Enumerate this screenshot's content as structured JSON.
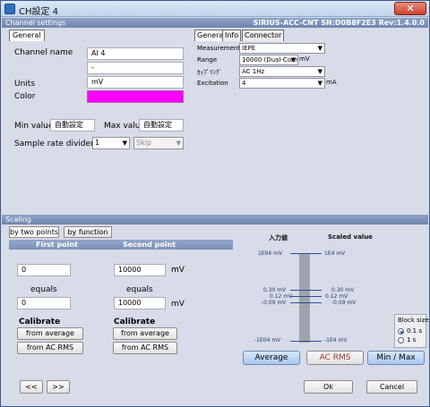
{
  "window": {
    "title": "CH設定 4",
    "close_label": "✕"
  },
  "channel_settings": {
    "section_title": "Channel settings",
    "device_info": "SIRIUS-ACC-CNT  SN:D0B8F2E3 Rev:1.4.0.0",
    "tabs": [
      "General"
    ],
    "channel_name_label": "Channel name",
    "channel_name_value": "AI 4",
    "channel_sub_value": "-",
    "units_label": "Units",
    "units_value": "mV",
    "color_label": "Color",
    "color_value": "#ff00ff",
    "min_label": "Min value",
    "min_value": "自動設定",
    "max_label": "Max value",
    "max_value": "自動設定",
    "sample_label": "Sample rate divider",
    "sample_value": "1",
    "sample_mode": "Skip",
    "right_tabs": [
      "General",
      "Info",
      "Connector"
    ],
    "measurement_label": "Measurement",
    "measurement_value": "IEPE",
    "range_label": "Range",
    "range_value": "10000 (Dual-Core)",
    "range_unit": "mV",
    "coupling_label": "ｶｯﾌﾟﾘﾝｸﾞ",
    "coupling_value": "AC 1Hz",
    "excitation_label": "Excitation",
    "excitation_value": "4",
    "excitation_unit": "mA"
  },
  "scaling": {
    "section_title": "Scaling",
    "tabs": [
      "by two points",
      "by function"
    ],
    "first_point": "First point",
    "second_point": "Second point",
    "first_value_top": "0",
    "first_value_bottom": "0",
    "second_value_top": "10000",
    "second_value_bottom": "10000",
    "unit_top": "mV",
    "unit_bottom": "mV",
    "equals": "equals",
    "calibrate_label": "Calibrate",
    "from_average": "from average",
    "from_ac_rms": "from AC RMS"
  },
  "visual": {
    "input_head": "入力値",
    "scaled_head": "Scaled value",
    "top_left": "1E04 mV",
    "top_right": "1E4 mV",
    "mid1_left": "0.30 mV",
    "mid1_right": "0.30 mV",
    "mid2_left": "0.12 mV",
    "mid2_right": "0.12 mV",
    "mid3_left": "-0.09 mV",
    "mid3_right": "-0.09 mV",
    "bottom_left": "-1E04 mV",
    "bottom_right": "-1E4 mV"
  },
  "block_size": {
    "title": "Block size",
    "options": [
      "0.1 s",
      "1 s"
    ],
    "selected": "0.1 s"
  },
  "actions": {
    "average": "Average",
    "ac_rms": "AC RMS",
    "min_max": "Min / Max",
    "prev": "<<",
    "next": ">>",
    "ok": "Ok",
    "cancel": "Cancel"
  }
}
